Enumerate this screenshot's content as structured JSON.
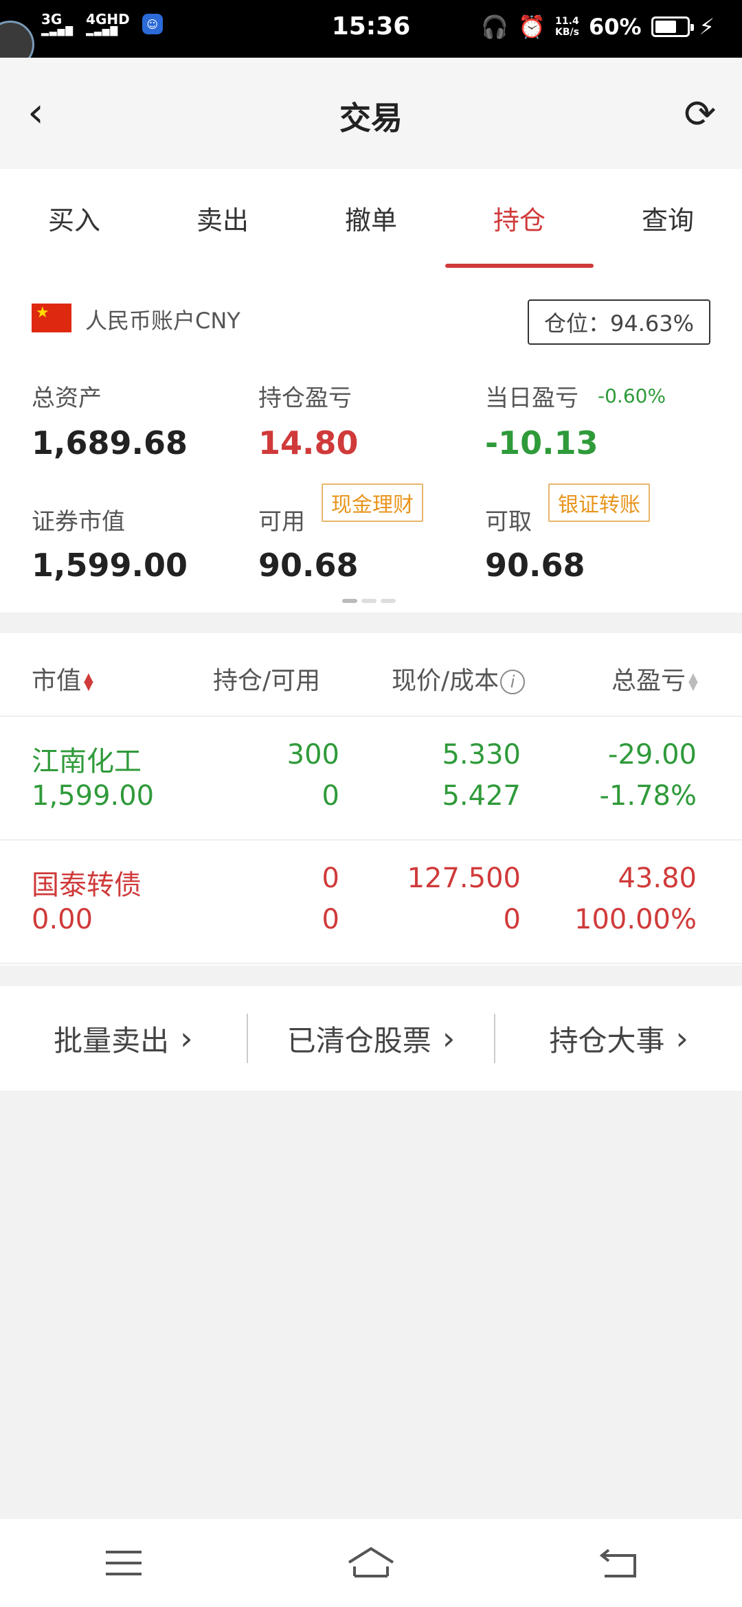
{
  "status_bar": {
    "signal_1": "3G",
    "signal_2": "4GHD",
    "time": "15:36",
    "speed_value": "11.4",
    "speed_unit": "KB/s",
    "battery_pct": "60%"
  },
  "header": {
    "title": "交易"
  },
  "tabs": [
    {
      "label": "买入",
      "active": false
    },
    {
      "label": "卖出",
      "active": false
    },
    {
      "label": "撤单",
      "active": false
    },
    {
      "label": "持仓",
      "active": true
    },
    {
      "label": "查询",
      "active": false
    }
  ],
  "account": {
    "name": "人民币账户CNY",
    "position_ratio": "仓位：94.63%",
    "total_assets_label": "总资产",
    "total_assets": "1,689.68",
    "holding_pnl_label": "持仓盈亏",
    "holding_pnl": "14.80",
    "daily_pnl_label": "当日盈亏",
    "daily_pnl_pct": "-0.60%",
    "daily_pnl": "-10.13",
    "market_value_label": "证券市值",
    "market_value": "1,599.00",
    "available_label": "可用",
    "cash_mgmt_label": "现金理财",
    "available": "90.68",
    "withdrawable_label": "可取",
    "bank_transfer_label": "银证转账",
    "withdrawable": "90.68"
  },
  "table": {
    "headers": {
      "market_value": "市值",
      "holding_available": "持仓/可用",
      "price_cost": "现价/成本",
      "total_pnl": "总盈亏"
    },
    "rows": [
      {
        "name": "江南化工",
        "market_value": "1,599.00",
        "holding": "300",
        "available": "0",
        "price": "5.330",
        "cost": "5.427",
        "pnl": "-29.00",
        "pnl_pct": "-1.78%",
        "color": "#2f9a3a"
      },
      {
        "name": "国泰转债",
        "market_value": "0.00",
        "holding": "0",
        "available": "0",
        "price": "127.500",
        "cost": "0",
        "pnl": "43.80",
        "pnl_pct": "100.00%",
        "color": "#d03a3a"
      }
    ]
  },
  "actions": {
    "batch_sell": "批量卖出",
    "cleared_stocks": "已清仓股票",
    "holding_events": "持仓大事"
  },
  "colors": {
    "accent_red": "#d03a3a",
    "gain_green": "#2f9a3a",
    "tag_orange": "#e8951e"
  }
}
